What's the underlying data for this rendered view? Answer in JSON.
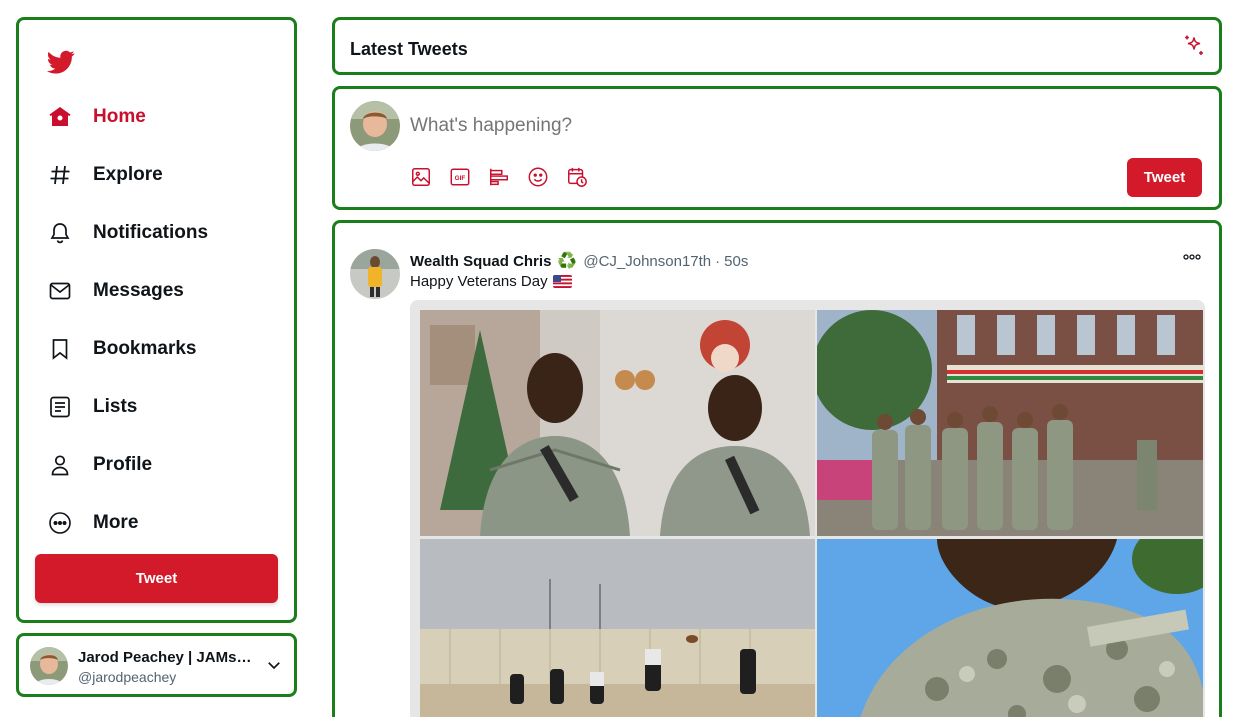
{
  "sidebar": {
    "items": [
      {
        "label": "Home",
        "icon": "home-icon",
        "active": true
      },
      {
        "label": "Explore",
        "icon": "hashtag-icon"
      },
      {
        "label": "Notifications",
        "icon": "bell-icon"
      },
      {
        "label": "Messages",
        "icon": "mail-icon"
      },
      {
        "label": "Bookmarks",
        "icon": "bookmark-icon"
      },
      {
        "label": "Lists",
        "icon": "list-icon"
      },
      {
        "label": "Profile",
        "icon": "person-icon"
      },
      {
        "label": "More",
        "icon": "more-circle-icon"
      }
    ],
    "tweet_label": "Tweet"
  },
  "account": {
    "name": "Jarod Peachey | JAMstack Developer",
    "handle": "@jarodpeachey"
  },
  "header": {
    "title": "Latest Tweets"
  },
  "composer": {
    "placeholder": "What's happening?",
    "tweet_label": "Tweet",
    "tools": [
      "image-icon",
      "gif-icon",
      "poll-icon",
      "emoji-icon",
      "schedule-icon"
    ]
  },
  "tweet": {
    "name": "Wealth Squad Chris",
    "name_emoji": "♻️",
    "handle": "@CJ_Johnson17th",
    "separator": "·",
    "time": "50s",
    "text": "Happy Veterans Day",
    "text_emoji": "🇺🇸",
    "photos": [
      "soldiers-christmas-photo",
      "soldiers-street-group-photo",
      "soldiers-desert-football-photo",
      "soldier-selfie-photo"
    ]
  },
  "colors": {
    "accent": "#d31a2b",
    "active_text": "#c8102e",
    "box_border": "#1a7f1a",
    "muted": "#536471"
  }
}
